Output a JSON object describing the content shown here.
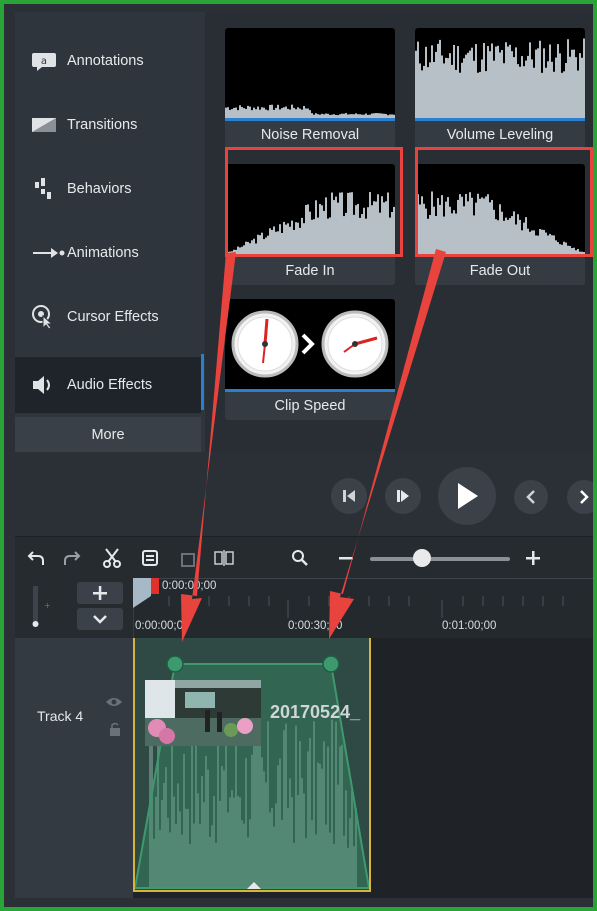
{
  "sidebar": {
    "items": [
      {
        "label": "Annotations",
        "icon": "annotation-icon"
      },
      {
        "label": "Transitions",
        "icon": "transition-icon"
      },
      {
        "label": "Behaviors",
        "icon": "behaviors-icon"
      },
      {
        "label": "Animations",
        "icon": "animation-arrow-icon"
      },
      {
        "label": "Cursor Effects",
        "icon": "cursor-icon"
      },
      {
        "label": "Audio Effects",
        "icon": "speaker-icon",
        "active": true
      }
    ],
    "more_label": "More"
  },
  "effects": [
    {
      "label": "Noise Removal",
      "highlighted": false
    },
    {
      "label": "Volume Leveling",
      "highlighted": false
    },
    {
      "label": "Fade In",
      "highlighted": true
    },
    {
      "label": "Fade Out",
      "highlighted": true
    },
    {
      "label": "Clip Speed",
      "highlighted": false
    }
  ],
  "timeline": {
    "playhead_time": "0:00:00;00",
    "ticks": [
      "0:00:00;00",
      "0:00:30;00",
      "0:01:00;00"
    ]
  },
  "track": {
    "label": "Track 4",
    "clip_name": "20170524_"
  },
  "colors": {
    "frame_border": "#2aa337",
    "highlight_red": "#e8433d",
    "accent_blue": "#2b7fd1",
    "clip_teal": "#2f4a44",
    "fade_green": "#3d9a6e",
    "clip_gold": "#d9b43a"
  }
}
